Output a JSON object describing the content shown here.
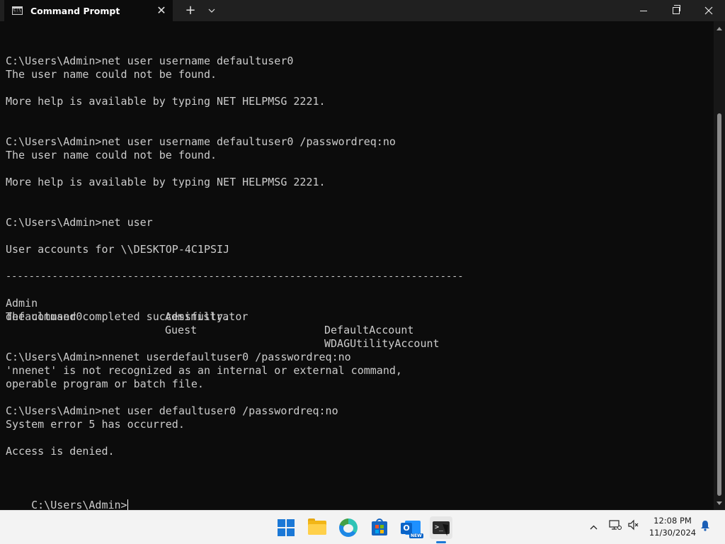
{
  "window": {
    "tab_title": "Command Prompt",
    "tab_close": "✕",
    "new_tab": "+",
    "dropdown": "⌄"
  },
  "console": {
    "lines": [
      "",
      "C:\\Users\\Admin>net user username defaultuser0",
      "The user name could not be found.",
      "",
      "More help is available by typing NET HELPMSG 2221.",
      "",
      "",
      "C:\\Users\\Admin>net user username defaultuser0 /passwordreq:no",
      "The user name could not be found.",
      "",
      "More help is available by typing NET HELPMSG 2221.",
      "",
      "",
      "C:\\Users\\Admin>net user",
      "",
      "User accounts for \\\\DESKTOP-4C1PSIJ",
      "",
      "-------------------------------------------------------------------------------",
      "",
      "",
      "The command completed successfully.",
      "",
      "",
      "C:\\Users\\Admin>nnenet userdefaultuser0 /passwordreq:no",
      "'nnenet' is not recognized as an internal or external command,",
      "operable program or batch file.",
      "",
      "C:\\Users\\Admin>net user defaultuser0 /passwordreq:no",
      "System error 5 has occurred.",
      "",
      "Access is denied.",
      "",
      "",
      "C:\\Users\\Admin>"
    ],
    "accounts": [
      [
        "Admin",
        "Administrator",
        "DefaultAccount"
      ],
      [
        "defaultuser0",
        "Guest",
        "WDAGUtilityAccount"
      ]
    ]
  },
  "taskbar": {
    "time": "12:08 PM",
    "date": "11/30/2024",
    "outlook_badge": "NEW",
    "outlook_letter": "O",
    "terminal_prompt": ">_"
  }
}
